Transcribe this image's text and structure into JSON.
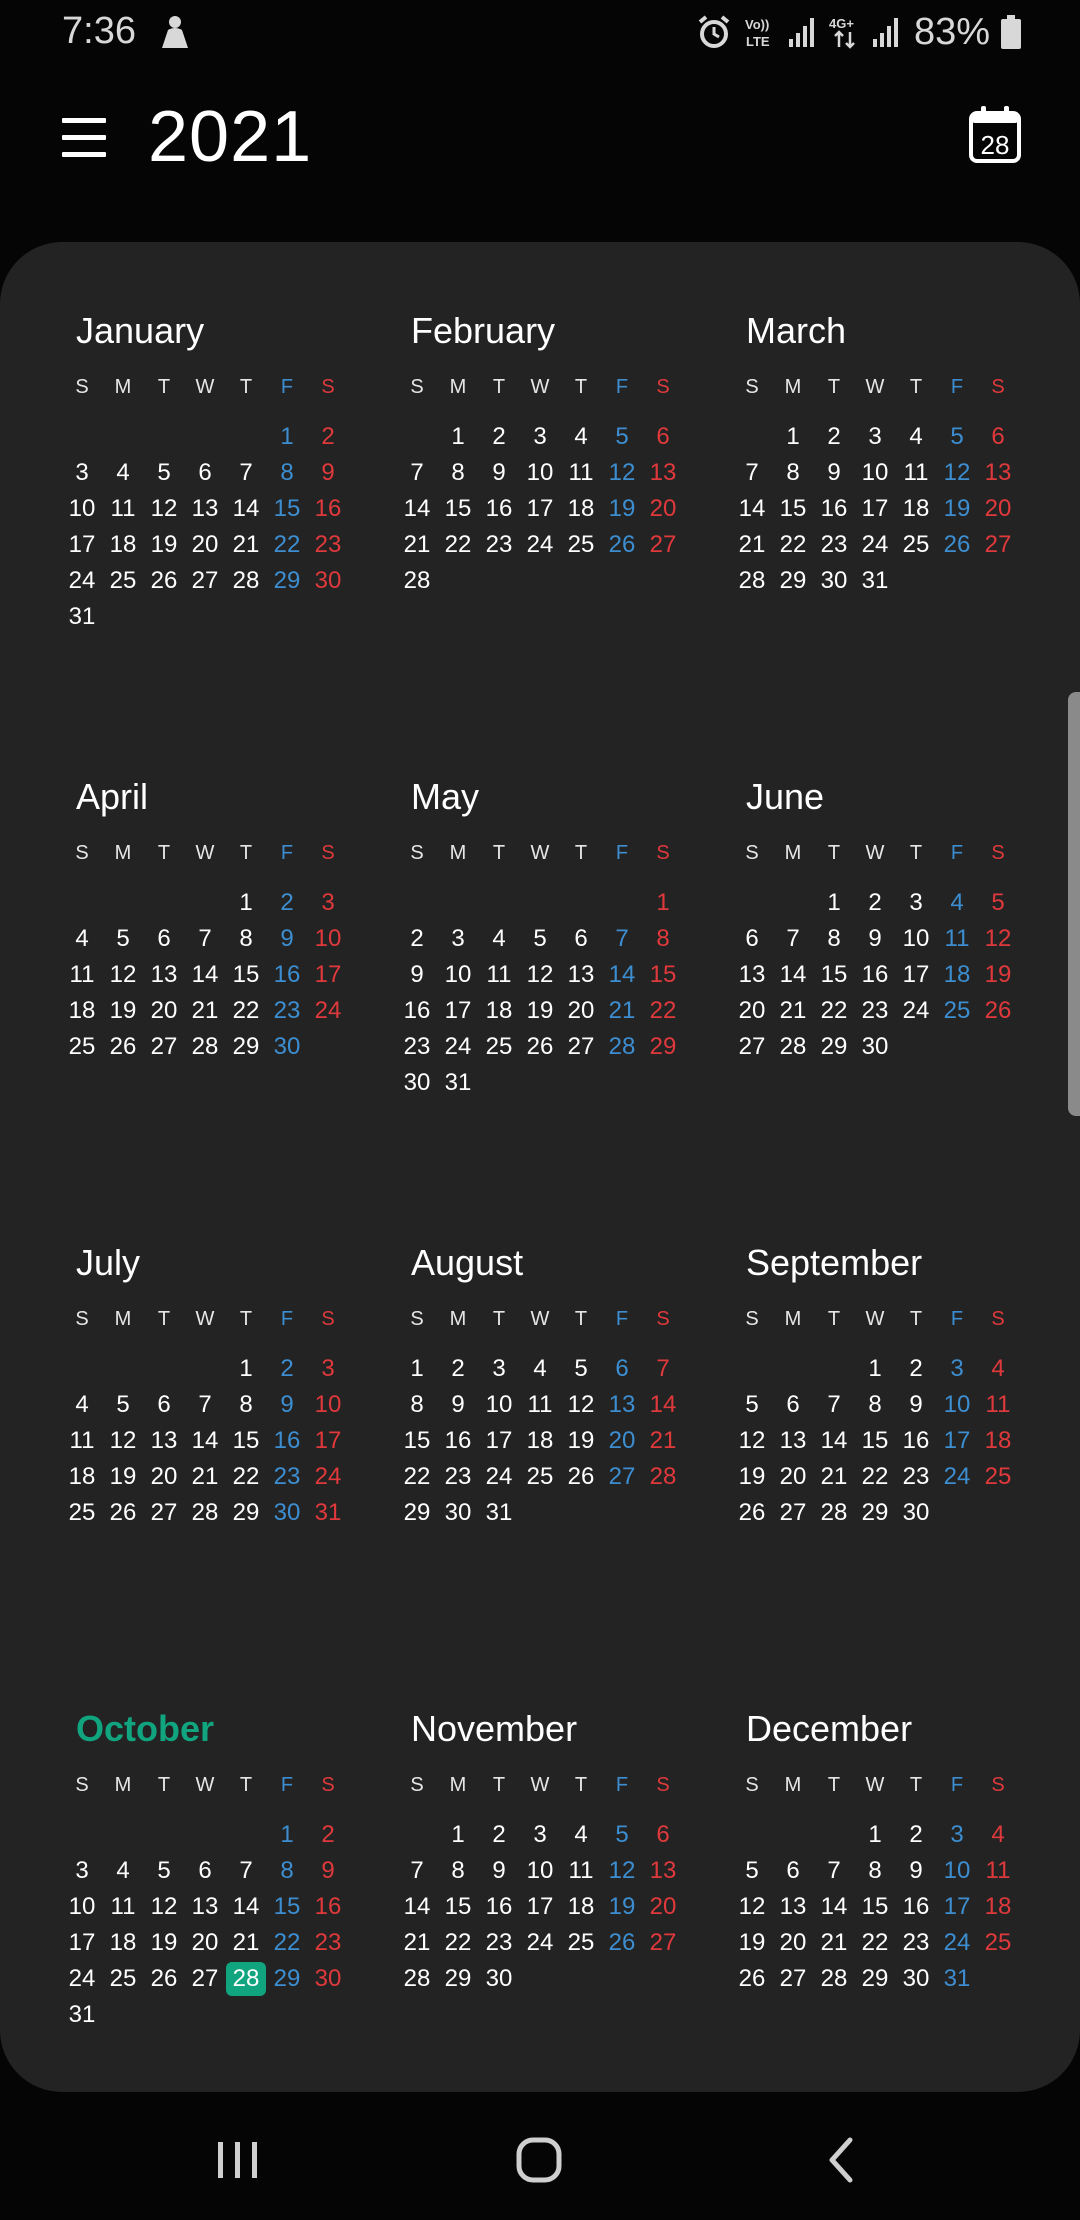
{
  "status_bar": {
    "time": "7:36",
    "battery": "83%",
    "volte_label": "Vo)) LTE",
    "network_label": "4G+"
  },
  "header": {
    "year": "2021",
    "today_icon_date": "28"
  },
  "colors": {
    "background": "#050505",
    "card": "#232323",
    "friday": "#3d8ed1",
    "saturday": "#e0393c",
    "today_accent": "#10a57f"
  },
  "weekday_headers": [
    "S",
    "M",
    "T",
    "W",
    "T",
    "F",
    "S"
  ],
  "today": {
    "month_index": 9,
    "day": 28
  },
  "months": [
    {
      "name": "January",
      "first_weekday": 5,
      "days": 31
    },
    {
      "name": "February",
      "first_weekday": 1,
      "days": 28
    },
    {
      "name": "March",
      "first_weekday": 1,
      "days": 31
    },
    {
      "name": "April",
      "first_weekday": 4,
      "days": 30
    },
    {
      "name": "May",
      "first_weekday": 6,
      "days": 31
    },
    {
      "name": "June",
      "first_weekday": 2,
      "days": 30
    },
    {
      "name": "July",
      "first_weekday": 4,
      "days": 31
    },
    {
      "name": "August",
      "first_weekday": 0,
      "days": 31
    },
    {
      "name": "September",
      "first_weekday": 3,
      "days": 30
    },
    {
      "name": "October",
      "first_weekday": 5,
      "days": 31
    },
    {
      "name": "November",
      "first_weekday": 1,
      "days": 30
    },
    {
      "name": "December",
      "first_weekday": 3,
      "days": 31
    }
  ],
  "nav_bar": {
    "recents_icon": "recents-icon",
    "home_icon": "home-icon",
    "back_icon": "back-icon"
  }
}
